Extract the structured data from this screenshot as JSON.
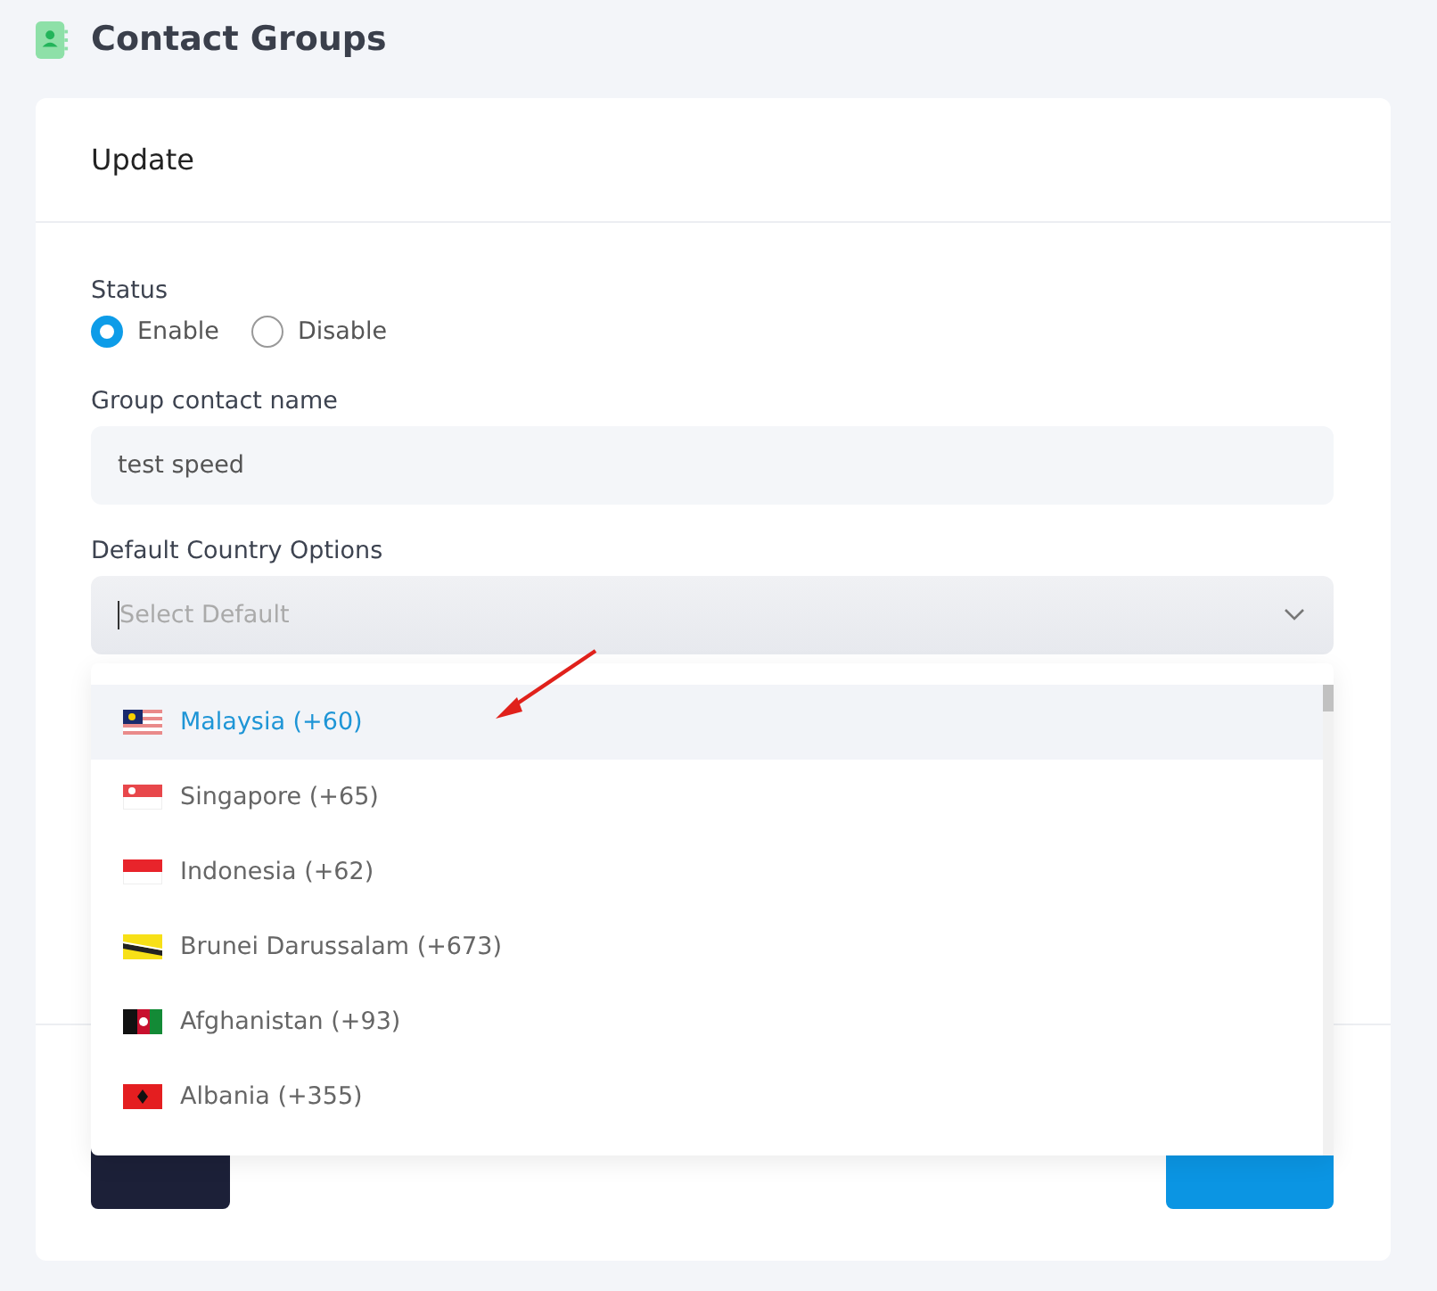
{
  "page": {
    "title": "Contact Groups"
  },
  "card": {
    "title": "Update"
  },
  "status": {
    "label": "Status",
    "options": [
      {
        "label": "Enable",
        "selected": true
      },
      {
        "label": "Disable",
        "selected": false
      }
    ]
  },
  "group_name": {
    "label": "Group contact name",
    "value": "test speed"
  },
  "country": {
    "label": "Default Country Options",
    "placeholder": "Select Default",
    "expanded": true,
    "options": [
      {
        "label": "Malaysia (+60)",
        "selected": true
      },
      {
        "label": "Singapore (+65)",
        "selected": false
      },
      {
        "label": "Indonesia (+62)",
        "selected": false
      },
      {
        "label": "Brunei Darussalam (+673)",
        "selected": false
      },
      {
        "label": "Afghanistan (+93)",
        "selected": false
      },
      {
        "label": "Albania (+355)",
        "selected": false
      }
    ]
  }
}
